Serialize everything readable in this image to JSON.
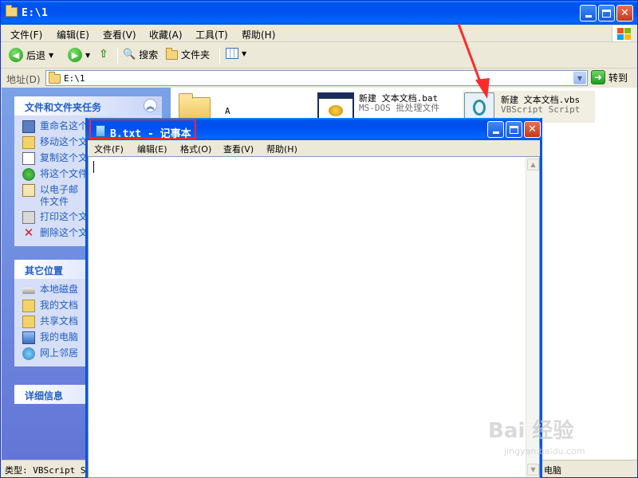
{
  "explorer": {
    "title": "E:\\1",
    "menu": [
      "文件(F)",
      "编辑(E)",
      "查看(V)",
      "收藏(A)",
      "工具(T)",
      "帮助(H)"
    ],
    "toolbar": {
      "back": "后退",
      "search": "搜索",
      "folders": "文件夹"
    },
    "address": {
      "label": "地址(D)",
      "value": "E:\\1",
      "go": "转到"
    },
    "file_tasks": {
      "title": "文件和文件夹任务",
      "items": [
        {
          "label": "重命名这个",
          "icon": "rename-icon"
        },
        {
          "label": "移动这个文",
          "icon": "move-icon"
        },
        {
          "label": "复制这个文",
          "icon": "copy-icon"
        },
        {
          "label": "将这个文件",
          "icon": "publish-icon"
        },
        {
          "label": "以电子邮件文件",
          "icon": "email-icon"
        },
        {
          "label": "打印这个文",
          "icon": "print-icon"
        },
        {
          "label": "删除这个文",
          "icon": "delete-icon"
        }
      ]
    },
    "other_places": {
      "title": "其它位置",
      "items": [
        {
          "label": "本地磁盘",
          "icon": "drive-icon"
        },
        {
          "label": "我的文档",
          "icon": "documents-icon"
        },
        {
          "label": "共享文档",
          "icon": "shared-folder-icon"
        },
        {
          "label": "我的电脑",
          "icon": "computer-icon"
        },
        {
          "label": "网上邻居",
          "icon": "network-icon"
        }
      ]
    },
    "details": {
      "title": "详细信息"
    },
    "files": [
      {
        "name": "A",
        "type": "folder"
      },
      {
        "name": "新建 文本文档.bat",
        "sub": "MS-DOS 批处理文件",
        "type": "bat"
      },
      {
        "name": "新建 文本文档.vbs",
        "sub": "VBScript Script ...",
        "type": "vbs"
      }
    ],
    "status": {
      "left": "类型: VBScript Sc",
      "right": "电脑"
    }
  },
  "notepad": {
    "title": "B.txt - 记事本",
    "menu": [
      "文件(F)",
      "编辑(E)",
      "格式(O)",
      "查看(V)",
      "帮助(H)"
    ],
    "content": ""
  },
  "watermark": {
    "main": "Bai 经验",
    "sub": "jingyan.baidu.com"
  },
  "colors": {
    "xp_blue": "#0053ee",
    "task_text": "#215dc6",
    "highlight_red": "#ff2a2a"
  }
}
